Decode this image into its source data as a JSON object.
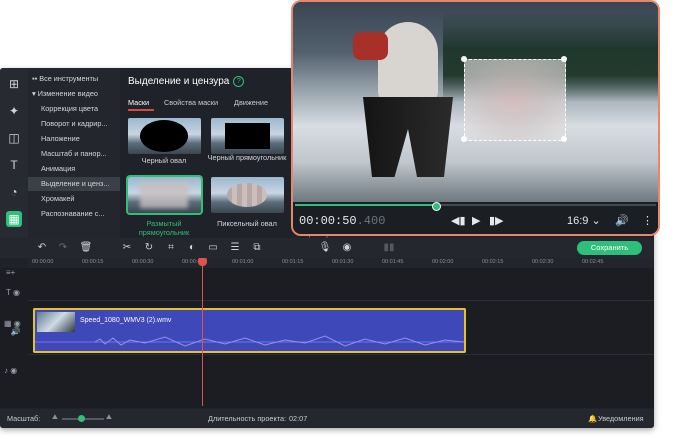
{
  "sidebar": {
    "icons": [
      "import-icon",
      "magic-wand-icon",
      "transitions-icon",
      "titles-icon",
      "stickers-icon",
      "more-tools-icon"
    ],
    "tree": [
      {
        "label": "Все инструменты",
        "type": "cat"
      },
      {
        "label": "Изменение видео",
        "type": "cat"
      },
      {
        "label": "Коррекция цвета"
      },
      {
        "label": "Поворот и кадрир..."
      },
      {
        "label": "Наложение"
      },
      {
        "label": "Масштаб и панор..."
      },
      {
        "label": "Анимация"
      },
      {
        "label": "Выделение и ценз...",
        "selected": true
      },
      {
        "label": "Хромакей"
      },
      {
        "label": "Распознавание с..."
      }
    ]
  },
  "panel": {
    "title": "Выделение и цензура",
    "tabs": [
      "Маски",
      "Свойства маски",
      "Движение"
    ],
    "masks": [
      {
        "label": "Черный овал"
      },
      {
        "label": "Черный прямоугольник"
      },
      {
        "label": "Размытый прямоугольник",
        "selected": true
      },
      {
        "label": "Пиксельный овал"
      }
    ],
    "overflow_label": "прямоугольник"
  },
  "toolbar": {
    "save_label": "Сохранить"
  },
  "ruler": {
    "ticks": [
      "00:00:00",
      "00:00:15",
      "00:00:30",
      "00:00:45",
      "00:01:00",
      "00:01:15",
      "00:01:30",
      "00:01:45",
      "00:02:00",
      "00:02:15",
      "00:02:30",
      "00:02:45"
    ]
  },
  "timeline": {
    "clip_name": "Speed_1080_WMV3 (2).wmv"
  },
  "status": {
    "zoom_label": "Масштаб:",
    "duration_label": "Длительность проекта:",
    "duration_value": "02:07",
    "notifications_label": "Уведомления"
  },
  "player": {
    "time_main": "00:00:50",
    "time_ms": ".400",
    "aspect": "16:9",
    "progress": 0.39
  },
  "colors": {
    "accent": "#2fbf7a",
    "playhead": "#e0524a",
    "clip": "#3e48b8",
    "clip_border": "#e3c329"
  }
}
